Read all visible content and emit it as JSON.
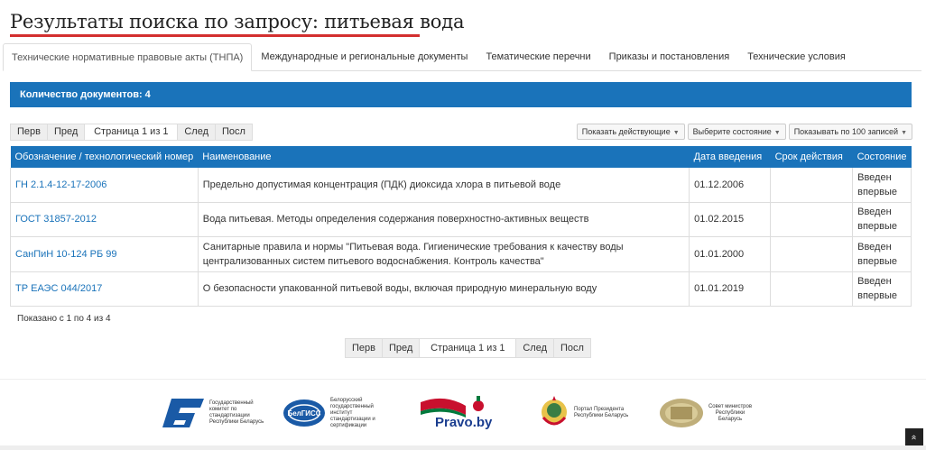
{
  "page_title": "Результаты поиска по запросу: питьевая вода",
  "tabs": [
    {
      "label": "Технические нормативные правовые акты (ТНПА)"
    },
    {
      "label": "Международные и региональные документы"
    },
    {
      "label": "Тематические перечни"
    },
    {
      "label": "Приказы и постановления"
    },
    {
      "label": "Технические условия"
    }
  ],
  "count_bar": "Количество документов: 4",
  "pager": {
    "first": "Перв",
    "prev": "Пред",
    "info": "Страница 1 из 1",
    "next": "След",
    "last": "Посл"
  },
  "filters": {
    "show_active": "Показать действующие",
    "select_state": "Выберите состояние",
    "per_page": "Показывать по 100 записей"
  },
  "table": {
    "headers": [
      "Обозначение / технологический номер",
      "Наименование",
      "Дата введения",
      "Срок действия",
      "Состояние"
    ],
    "rows": [
      {
        "code": "ГН 2.1.4-12-17-2006",
        "name": "Предельно допустимая концентрация (ПДК) диоксида хлора в питьевой воде",
        "date": "01.12.2006",
        "term": "",
        "state": "Введен впервые"
      },
      {
        "code": "ГОСТ 31857-2012",
        "name": "Вода питьевая. Методы определения содержания поверхностно-активных веществ",
        "date": "01.02.2015",
        "term": "",
        "state": "Введен впервые"
      },
      {
        "code": "СанПиН 10-124 РБ 99",
        "name": "Санитарные правила и нормы \"Питьевая вода. Гигиенические требования к качеству воды централизованных систем питьевого водоснабжения. Контроль качества\"",
        "date": "01.01.2000",
        "term": "",
        "state": "Введен впервые"
      },
      {
        "code": "ТР ЕАЭС 044/2017",
        "name": "О безопасности упакованной питьевой воды, включая природную минеральную воду",
        "date": "01.01.2019",
        "term": "",
        "state": "Введен впервые"
      }
    ]
  },
  "shown_text": "Показано с 1 по 4 из 4",
  "footer": {
    "gosstandart": "Государственный комитет по стандартизации Республики Беларусь",
    "belgiss": "Белорусский государственный институт стандартизации и сертификации",
    "belgiss_logo": "БелГИСС",
    "pravo": "Pravo.by",
    "president": "Портал Президента Республики Беларусь",
    "council": "Совет министров Республики Беларусь"
  },
  "colors": {
    "accent": "#1a73ba",
    "title_underline": "#d32f2f"
  },
  "icons": {
    "to_top": "chevron-up-double-icon"
  }
}
